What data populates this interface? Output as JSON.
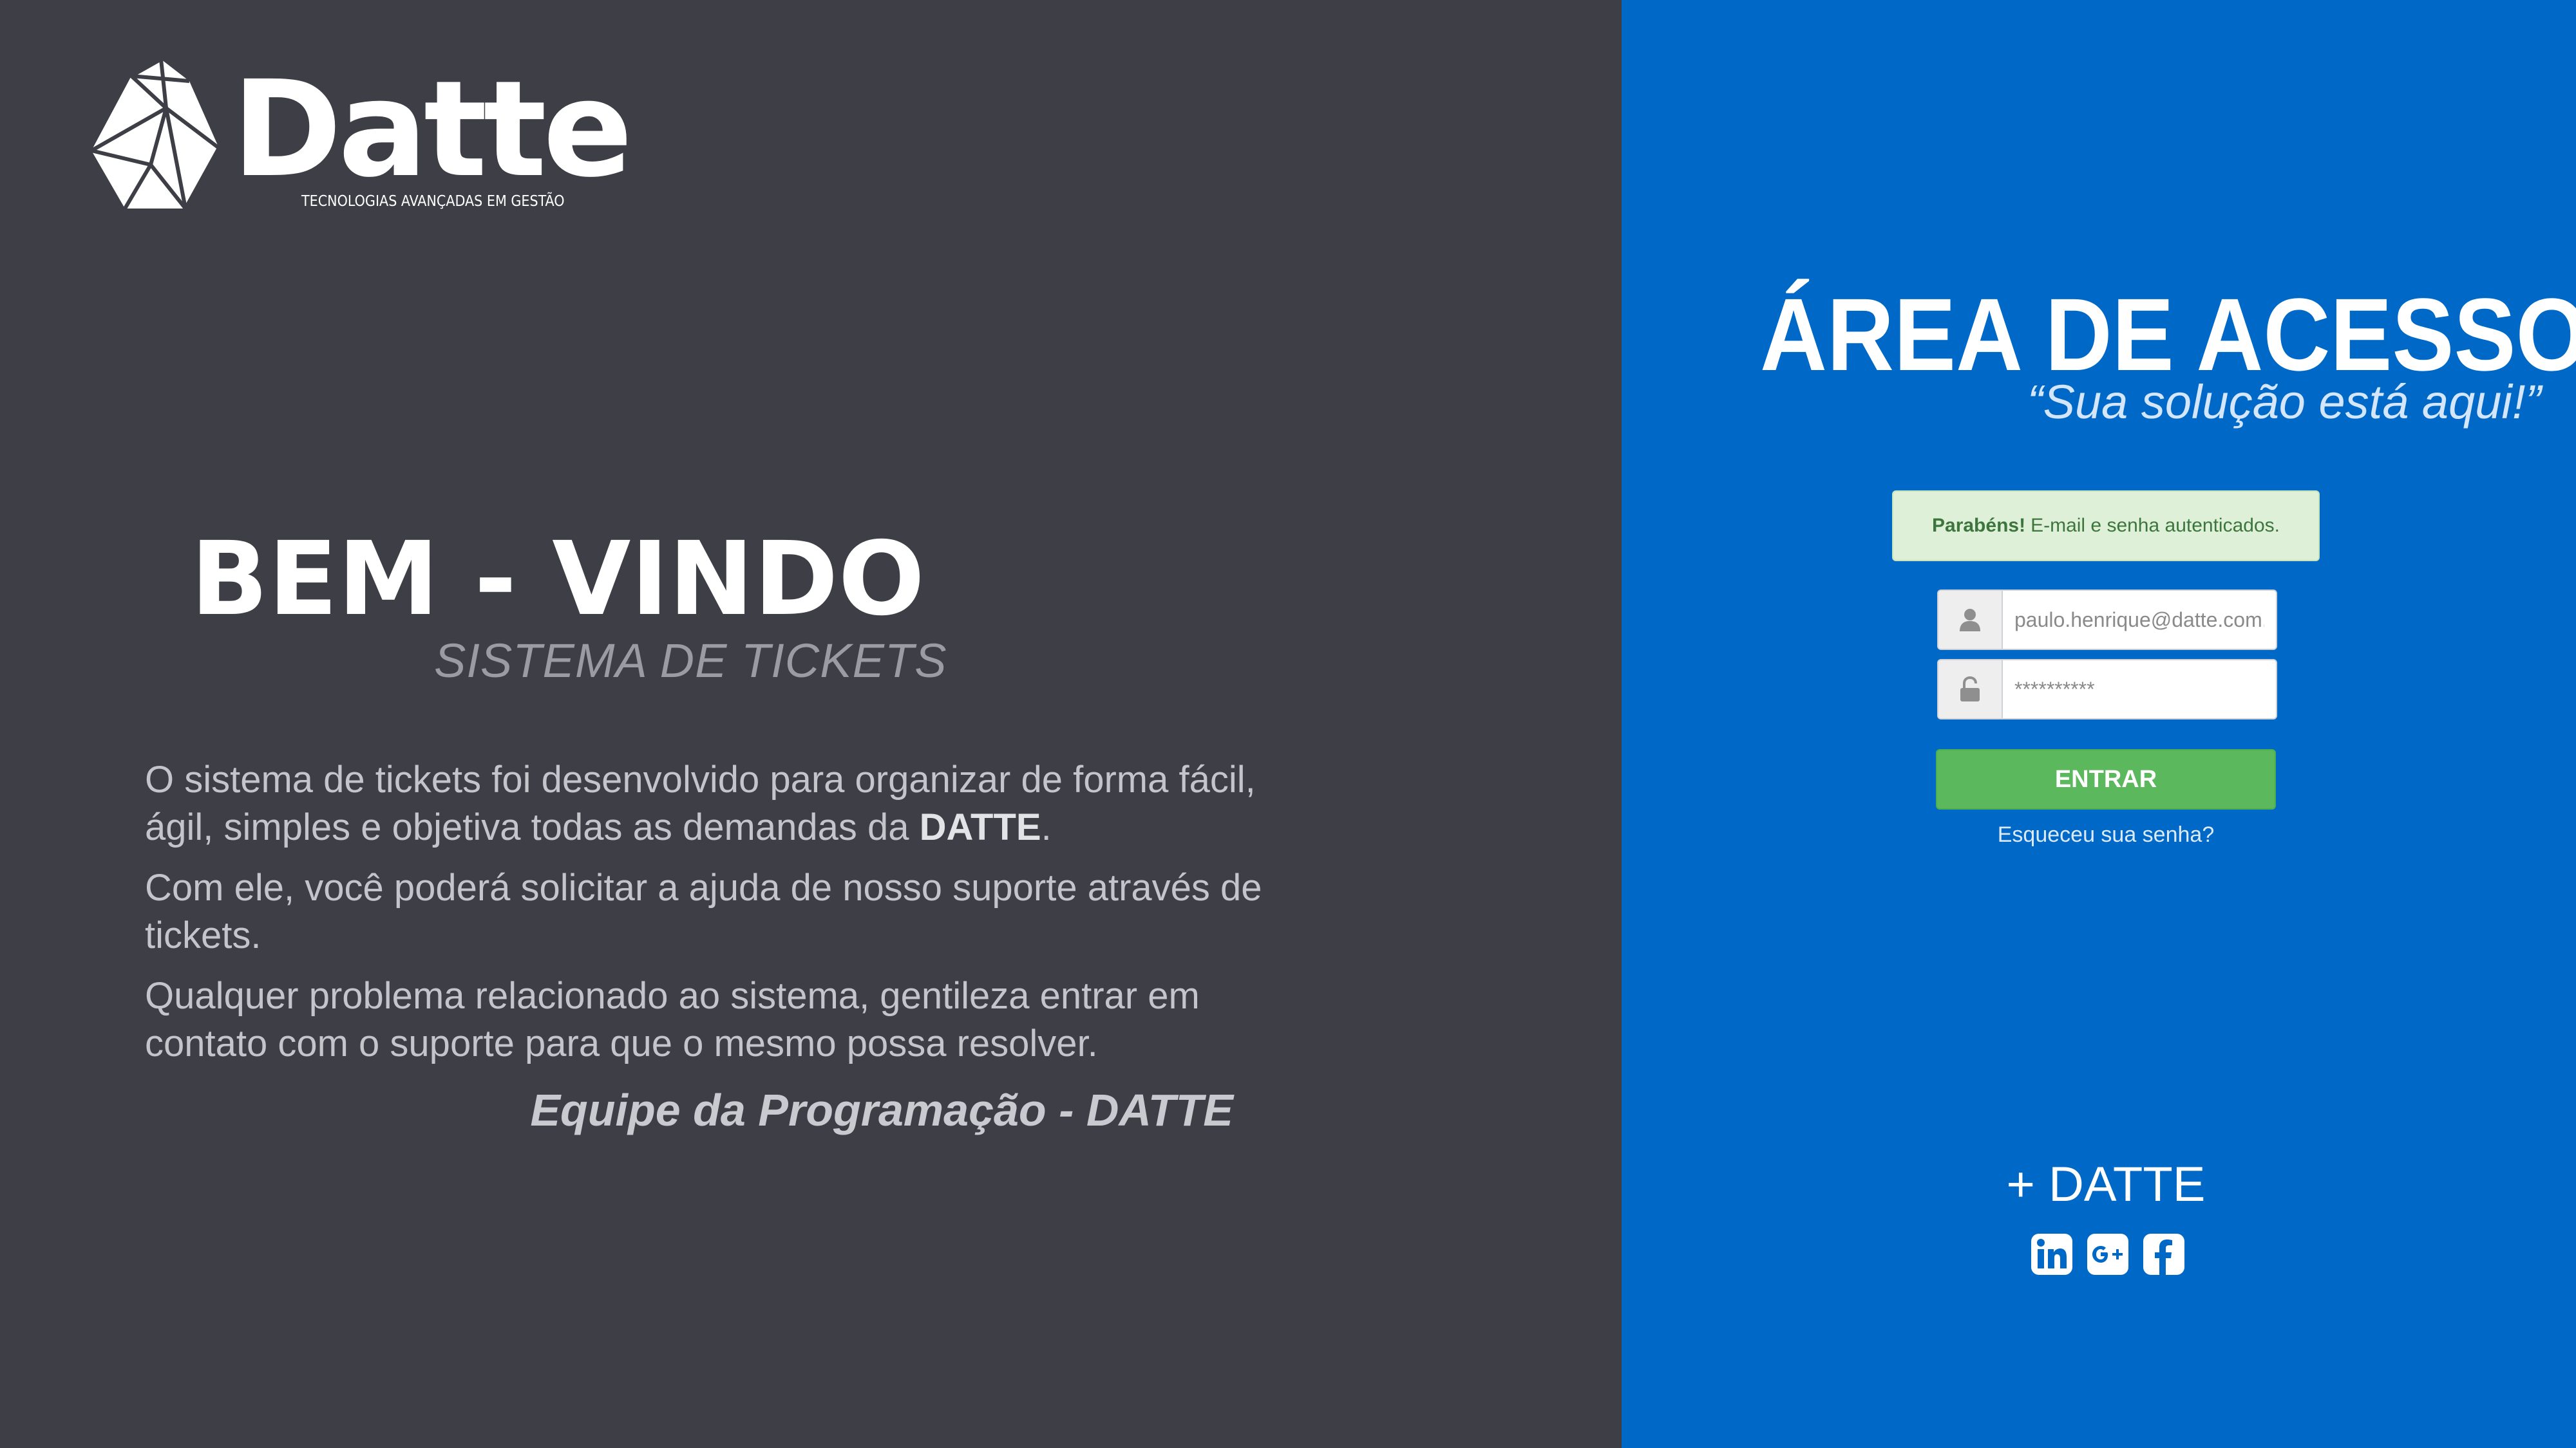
{
  "brand": {
    "name": "Datte",
    "tagline": "TECNOLOGIAS AVANÇADAS EM GESTÃO",
    "logo_icon": "faceted-polygon-logo-icon"
  },
  "welcome": {
    "title": "BEM - VINDO",
    "subtitle": "SISTEMA DE TICKETS",
    "paragraphs": [
      {
        "text": "O sistema de tickets foi desenvolvido para organizar de forma fácil, ágil, simples e objetiva todas as demandas da ",
        "bold": "DATTE",
        "end": "."
      },
      {
        "text": "Com ele, você poderá solicitar a ajuda de nosso suporte através de tickets."
      },
      {
        "text": "Qualquer problema relacionado ao sistema, gentileza entrar em contato com o suporte para que o mesmo possa resolver."
      }
    ],
    "signature": "Equipe da Programação - DATTE"
  },
  "access": {
    "title": "ÁREA DE ACESSO",
    "subtitle": "“Sua solução está aqui!”",
    "alert": {
      "strong": "Parabéns!",
      "text": "E-mail e senha autenticados."
    },
    "email": {
      "value": "paulo.henrique@datte.com.br",
      "icon": "user-icon"
    },
    "password": {
      "value": "**********",
      "icon": "unlock-icon"
    },
    "submit_label": "ENTRAR",
    "forgot_label": "Esqueceu sua senha?"
  },
  "footer": {
    "more_label": "+ DATTE",
    "social": [
      {
        "name": "linkedin-icon"
      },
      {
        "name": "google-plus-icon"
      },
      {
        "name": "facebook-icon"
      }
    ]
  },
  "colors": {
    "left_bg": "#3d3e46",
    "right_bg": "#0069c8",
    "success_bg": "#dff0d8",
    "button_green": "#5cb85c"
  }
}
